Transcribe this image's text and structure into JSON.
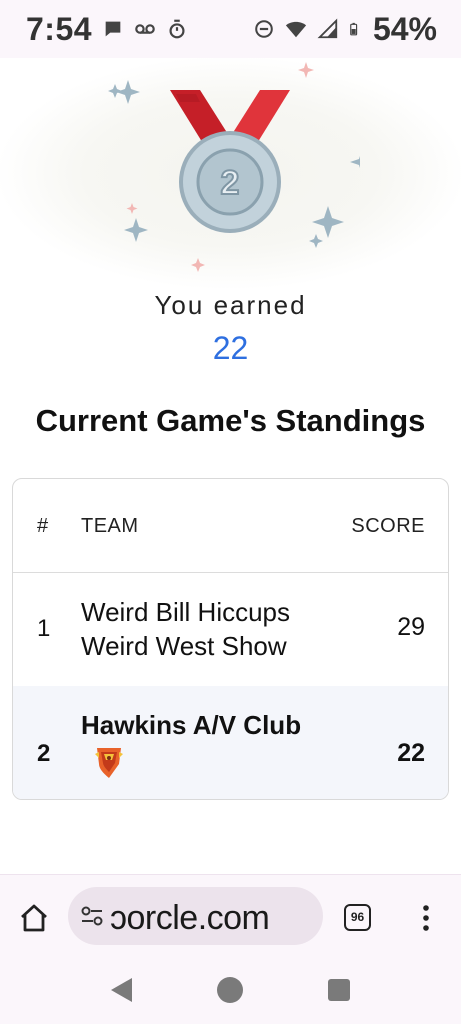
{
  "status_bar": {
    "time": "7:54",
    "battery": "54%"
  },
  "result": {
    "medal_number": "2",
    "earned_label": "You earned",
    "earned_value": "22"
  },
  "standings": {
    "title": "Current Game's Standings",
    "columns": {
      "rank": "#",
      "team": "TEAM",
      "score": "SCORE"
    },
    "rows": [
      {
        "rank": "1",
        "team": "Weird Bill Hiccups Weird West Show",
        "score": "29"
      },
      {
        "rank": "2",
        "team": "Hawkins A/V Club",
        "score": "22"
      }
    ]
  },
  "browser": {
    "url": "ɔorcle.com",
    "tab_count": "96"
  },
  "colors": {
    "accent_blue": "#2e6fe0",
    "medal_ribbon": "#d9262e",
    "medal_silver": "#b9c9d3",
    "highlight_row": "#f4f6fb"
  }
}
